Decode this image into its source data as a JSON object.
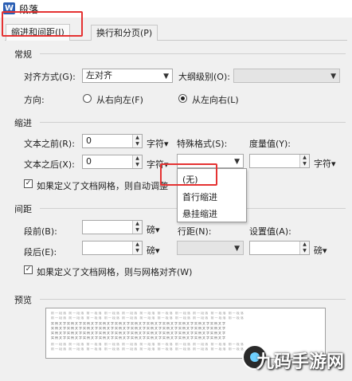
{
  "window": {
    "title": "段落",
    "app_icon": "W"
  },
  "tabs": [
    {
      "label": "缩进和间距(I)",
      "active": true
    },
    {
      "label": "换行和分页(P)",
      "active": false
    }
  ],
  "general": {
    "section_label": "常规",
    "alignment_label": "对齐方式(G):",
    "alignment_value": "左对齐",
    "outline_label": "大纲级别(O):",
    "outline_value": "",
    "direction_label": "方向:",
    "rtl_label": "从右向左(F)",
    "ltr_label": "从左向右(L)",
    "direction_selected": "ltr"
  },
  "indent": {
    "section_label": "缩进",
    "before_label": "文本之前(R):",
    "before_value": "0",
    "after_label": "文本之后(X):",
    "after_value": "0",
    "unit": "字符▾",
    "special_label": "特殊格式(S):",
    "special_value": "",
    "measure_label": "度量值(Y):",
    "measure_value": "",
    "measure_unit": "字符▾",
    "grid_check_label": "如果定义了文档网格，则自动调整",
    "grid_checked": true
  },
  "special_dropdown": {
    "options": [
      "(无)",
      "首行缩进",
      "悬挂缩进"
    ],
    "highlighted": "(无)"
  },
  "spacing": {
    "section_label": "间距",
    "before_label": "段前(B):",
    "before_value": "",
    "after_label": "段后(E):",
    "after_value": "",
    "unit": "磅▾",
    "line_label": "行距(N):",
    "line_value": "",
    "setting_label": "设置值(A):",
    "setting_value": "",
    "setting_unit": "磅▾",
    "grid_check_label": "如果定义了文档网格，则与网格对齐(W)",
    "grid_checked": true
  },
  "preview": {
    "section_label": "预览",
    "light_text": "前一段落 前一段落 前一段落 前一段落 前一段落 前一段落 前一段落 前一段落 前一段落 前一段落 前一段落",
    "dark_text": "实例文字实例文字实例文字实例文字实例文字实例文字实例文字实例文字实例文字实例文字实例文字"
  },
  "watermark": {
    "text": "九码手游网"
  },
  "colors": {
    "highlight_box": "#e53232",
    "app_icon": "#2b5fb4"
  }
}
